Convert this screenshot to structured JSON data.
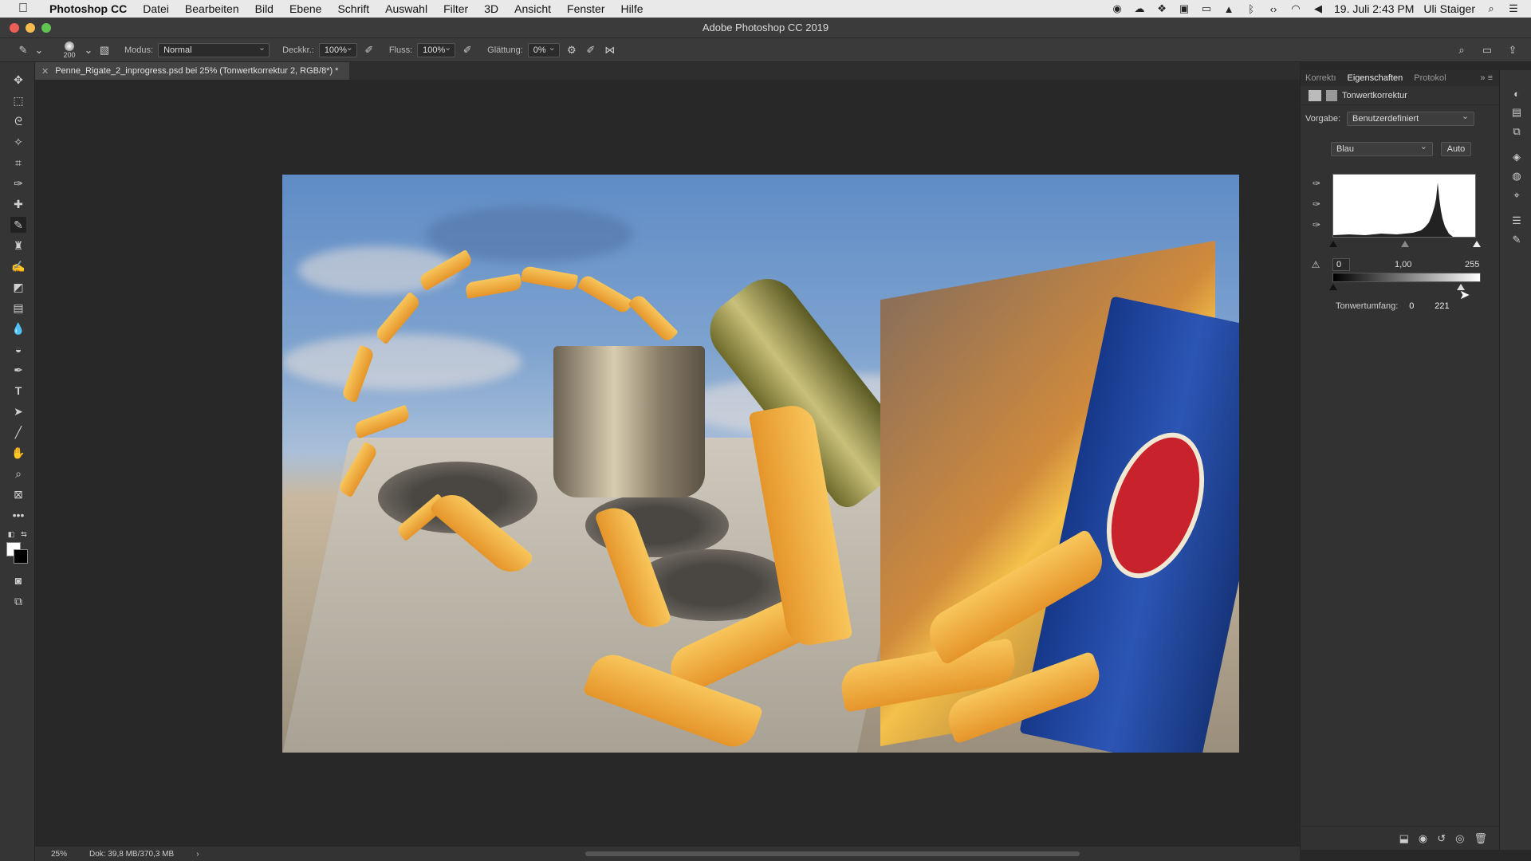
{
  "menubar": {
    "app_name": "Photoshop CC",
    "items": [
      "Datei",
      "Bearbeiten",
      "Bild",
      "Ebene",
      "Schrift",
      "Auswahl",
      "Filter",
      "3D",
      "Ansicht",
      "Fenster",
      "Hilfe"
    ],
    "datetime": "19. Juli  2:43 PM",
    "user": "Uli Staiger"
  },
  "window": {
    "title": "Adobe Photoshop CC 2019"
  },
  "options": {
    "brush_size": "200",
    "mode_label": "Modus:",
    "mode_value": "Normal",
    "opacity_label": "Deckkr.:",
    "opacity_value": "100%",
    "flow_label": "Fluss:",
    "flow_value": "100%",
    "smoothing_label": "Glättung:",
    "smoothing_value": "0%"
  },
  "document": {
    "tab_title": "Penne_Rigate_2_inprogress.psd bei 25% (Tonwertkorrektur 2, RGB/8*) *"
  },
  "panel": {
    "tabs": [
      "Korrektı",
      "Eigenschaften",
      "Protokol"
    ],
    "active_tab": "Eigenschaften",
    "layer_title": "Tonwertkorrektur",
    "preset_label": "Vorgabe:",
    "preset_value": "Benutzerdefiniert",
    "channel_value": "Blau",
    "auto_label": "Auto",
    "input_black": "0",
    "input_gamma": "1,00",
    "input_white": "255",
    "output_label": "Tonwertumfang:",
    "output_black": "0",
    "output_white": "221"
  },
  "status": {
    "zoom": "25%",
    "doc_size": "Dok: 39,8 MB/370,3 MB",
    "arrow": "›"
  },
  "colors": {
    "accent_close": "#ec5f57",
    "accent_min": "#f5bd4f",
    "accent_max": "#61c453"
  }
}
